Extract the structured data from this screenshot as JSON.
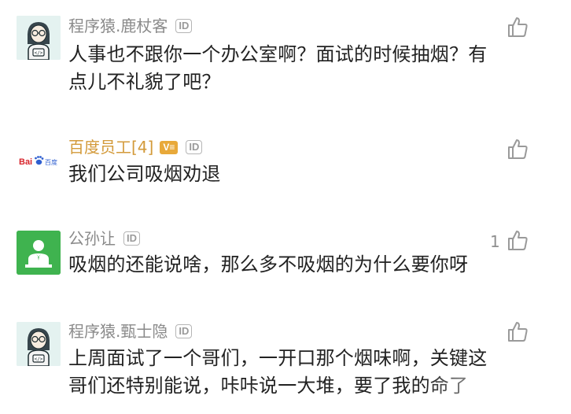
{
  "comments": [
    {
      "user": "程序猿.鹿杖客",
      "id_badge": "ID",
      "text": "人事也不跟你一个办公室啊？面试的时候抽烟？有点儿不礼貌了吧？",
      "avatar": "coder-avatar",
      "like_icon": "thumbs-up-icon",
      "likes": ""
    },
    {
      "user": "百度员工[4]",
      "v_badge": "V≡",
      "id_badge": "ID",
      "text": "我们公司吸烟劝退",
      "avatar": "baidu-logo",
      "avatar_text": "Bai百度",
      "like_icon": "thumbs-up-icon",
      "likes": ""
    },
    {
      "user": "公孙让",
      "id_badge": "ID",
      "text": "吸烟的还能说啥，那么多不吸烟的为什么要你呀",
      "avatar": "person-avatar",
      "like_icon": "thumbs-up-icon",
      "likes": "1"
    },
    {
      "user": "程序猿.甄士隐",
      "id_badge": "ID",
      "text": "上周面试了一个哥们，一开口那个烟味啊，关键这哥们还特别能说，咔咔说一大堆，要了我的命了",
      "avatar": "coder-avatar",
      "like_icon": "thumbs-up-icon",
      "likes": ""
    }
  ],
  "colors": {
    "username": "#8a8a8a",
    "baidu_username": "#d39a3a",
    "text": "#222222",
    "avatar_green": "#3fb34f",
    "coder_bg": "#e4f2f0"
  }
}
